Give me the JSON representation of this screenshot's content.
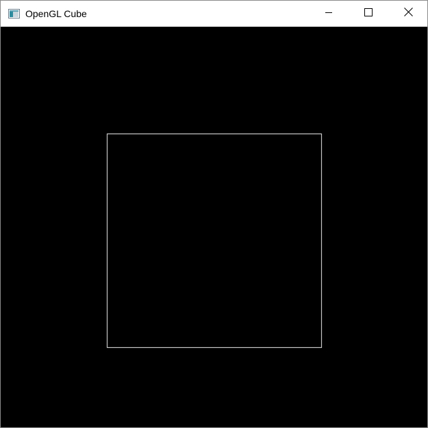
{
  "window": {
    "title": "OpenGL Cube",
    "icon": "opengl-app-icon",
    "controls": {
      "minimize_icon": "minimize-icon",
      "maximize_icon": "maximize-icon",
      "close_icon": "close-icon"
    }
  },
  "viewport": {
    "background_color": "#000000",
    "line_color": "#c8c8c8",
    "shape": "wireframe-square"
  }
}
